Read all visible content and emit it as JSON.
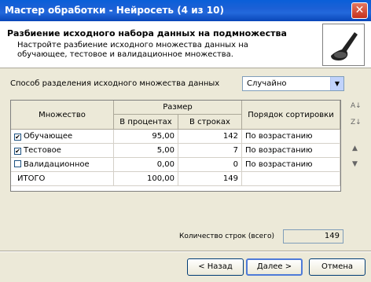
{
  "window": {
    "title": "Мастер обработки - Нейросеть (4 из 10)"
  },
  "header": {
    "title": "Разбиение исходного набора данных на подмножества",
    "description": "Настройте разбиение исходного множества данных на обучающее, тестовое и валидационное множества."
  },
  "split": {
    "label": "Способ разделения исходного множества данных",
    "value": "Случайно"
  },
  "table": {
    "col_set": "Множество",
    "col_size": "Размер",
    "col_percent": "В процентах",
    "col_rows": "В строках",
    "col_order": "Порядок сортировки",
    "rows": [
      {
        "checked": true,
        "name": "Обучающее",
        "percent": "95,00",
        "rows": "142",
        "order": "По возрастанию"
      },
      {
        "checked": true,
        "name": "Тестовое",
        "percent": "5,00",
        "rows": "7",
        "order": "По возрастанию"
      },
      {
        "checked": false,
        "name": "Валидационное",
        "percent": "0,00",
        "rows": "0",
        "order": "По возрастанию"
      }
    ],
    "total": {
      "name": "ИТОГО",
      "percent": "100,00",
      "rows": "149"
    }
  },
  "footer": {
    "count_label": "Количество строк (всего)",
    "count_value": "149"
  },
  "buttons": {
    "back": "< Назад",
    "next": "Далее >",
    "cancel": "Отмена"
  }
}
